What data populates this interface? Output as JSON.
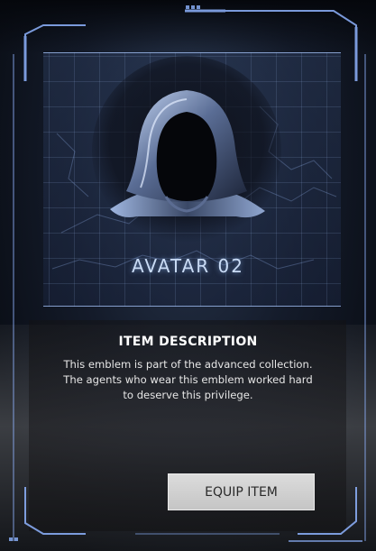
{
  "item": {
    "name": "AVATAR 02",
    "icon": "hooded-figure-icon"
  },
  "description": {
    "title": "ITEM DESCRIPTION",
    "lines": [
      "This emblem is part of the advanced collection.",
      "The agents who wear this emblem worked hard",
      "to deserve this privilege."
    ]
  },
  "actions": {
    "equip_label": "EQUIP ITEM"
  },
  "colors": {
    "frame_accent": "#8fb4ff",
    "holo_text": "#c9dbf5",
    "button_bg": "#d2d2d2"
  }
}
